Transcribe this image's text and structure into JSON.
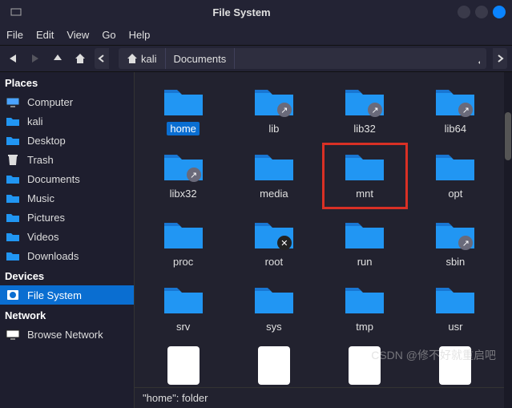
{
  "window": {
    "title": "File System"
  },
  "menu": {
    "file": "File",
    "edit": "Edit",
    "view": "View",
    "go": "Go",
    "help": "Help"
  },
  "path": {
    "seg1": "kali",
    "seg2": "Documents"
  },
  "sidebar": {
    "places_head": "Places",
    "devices_head": "Devices",
    "network_head": "Network",
    "places": [
      {
        "label": "Computer",
        "icon": "monitor"
      },
      {
        "label": "kali",
        "icon": "folder-blue"
      },
      {
        "label": "Desktop",
        "icon": "folder-blue"
      },
      {
        "label": "Trash",
        "icon": "trash"
      },
      {
        "label": "Documents",
        "icon": "folder-blue"
      },
      {
        "label": "Music",
        "icon": "folder-blue"
      },
      {
        "label": "Pictures",
        "icon": "folder-blue"
      },
      {
        "label": "Videos",
        "icon": "folder-blue"
      },
      {
        "label": "Downloads",
        "icon": "folder-blue"
      }
    ],
    "devices": [
      {
        "label": "File System",
        "icon": "disk"
      }
    ],
    "network": [
      {
        "label": "Browse Network",
        "icon": "network"
      }
    ]
  },
  "folders": [
    {
      "name": "home",
      "selected": true,
      "link": false
    },
    {
      "name": "lib",
      "link": true
    },
    {
      "name": "lib32",
      "link": true
    },
    {
      "name": "lib64",
      "link": true
    },
    {
      "name": "libx32",
      "link": true
    },
    {
      "name": "media",
      "link": false
    },
    {
      "name": "mnt",
      "link": false,
      "highlighted": true
    },
    {
      "name": "opt",
      "link": false
    },
    {
      "name": "proc",
      "link": false
    },
    {
      "name": "root",
      "link": false,
      "noaccess": true
    },
    {
      "name": "run",
      "link": false
    },
    {
      "name": "sbin",
      "link": true
    },
    {
      "name": "srv",
      "link": false
    },
    {
      "name": "sys",
      "link": false
    },
    {
      "name": "tmp",
      "link": false
    },
    {
      "name": "usr",
      "link": false
    }
  ],
  "files_row": [
    "",
    "",
    "",
    ""
  ],
  "status": "\"home\": folder",
  "watermark": "CSDN @修不好就重启吧"
}
